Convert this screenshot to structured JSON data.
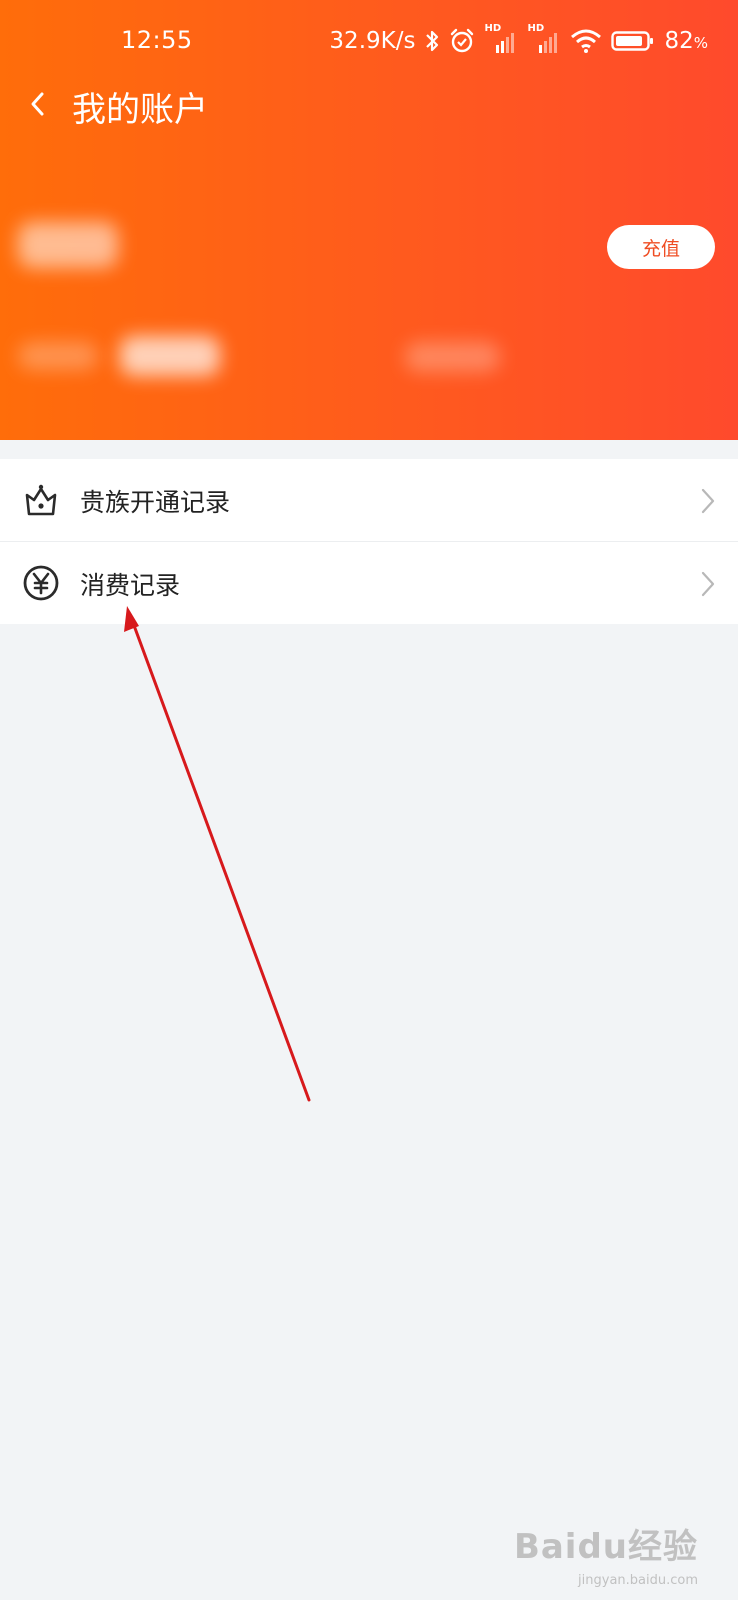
{
  "status_bar": {
    "time": "12:55",
    "net_speed": "32.9K/s",
    "battery_percent": "82",
    "battery_unit": "%",
    "signal_label_1": "HD",
    "signal_label_2": "HD"
  },
  "header": {
    "title": "我的账户",
    "recharge_label": "充值"
  },
  "menu": {
    "items": [
      {
        "label": "贵族开通记录",
        "icon": "crown-icon"
      },
      {
        "label": "消费记录",
        "icon": "yen-coin-icon"
      }
    ]
  },
  "watermark": {
    "text": "Baidu经验",
    "sub": "jingyan.baidu.com"
  },
  "colors": {
    "header_gradient_start": "#ff6d0a",
    "header_gradient_end": "#ff4a2c",
    "accent_text": "#ef4d23",
    "page_bg": "#f2f4f6",
    "annotation_arrow": "#d7191c"
  }
}
